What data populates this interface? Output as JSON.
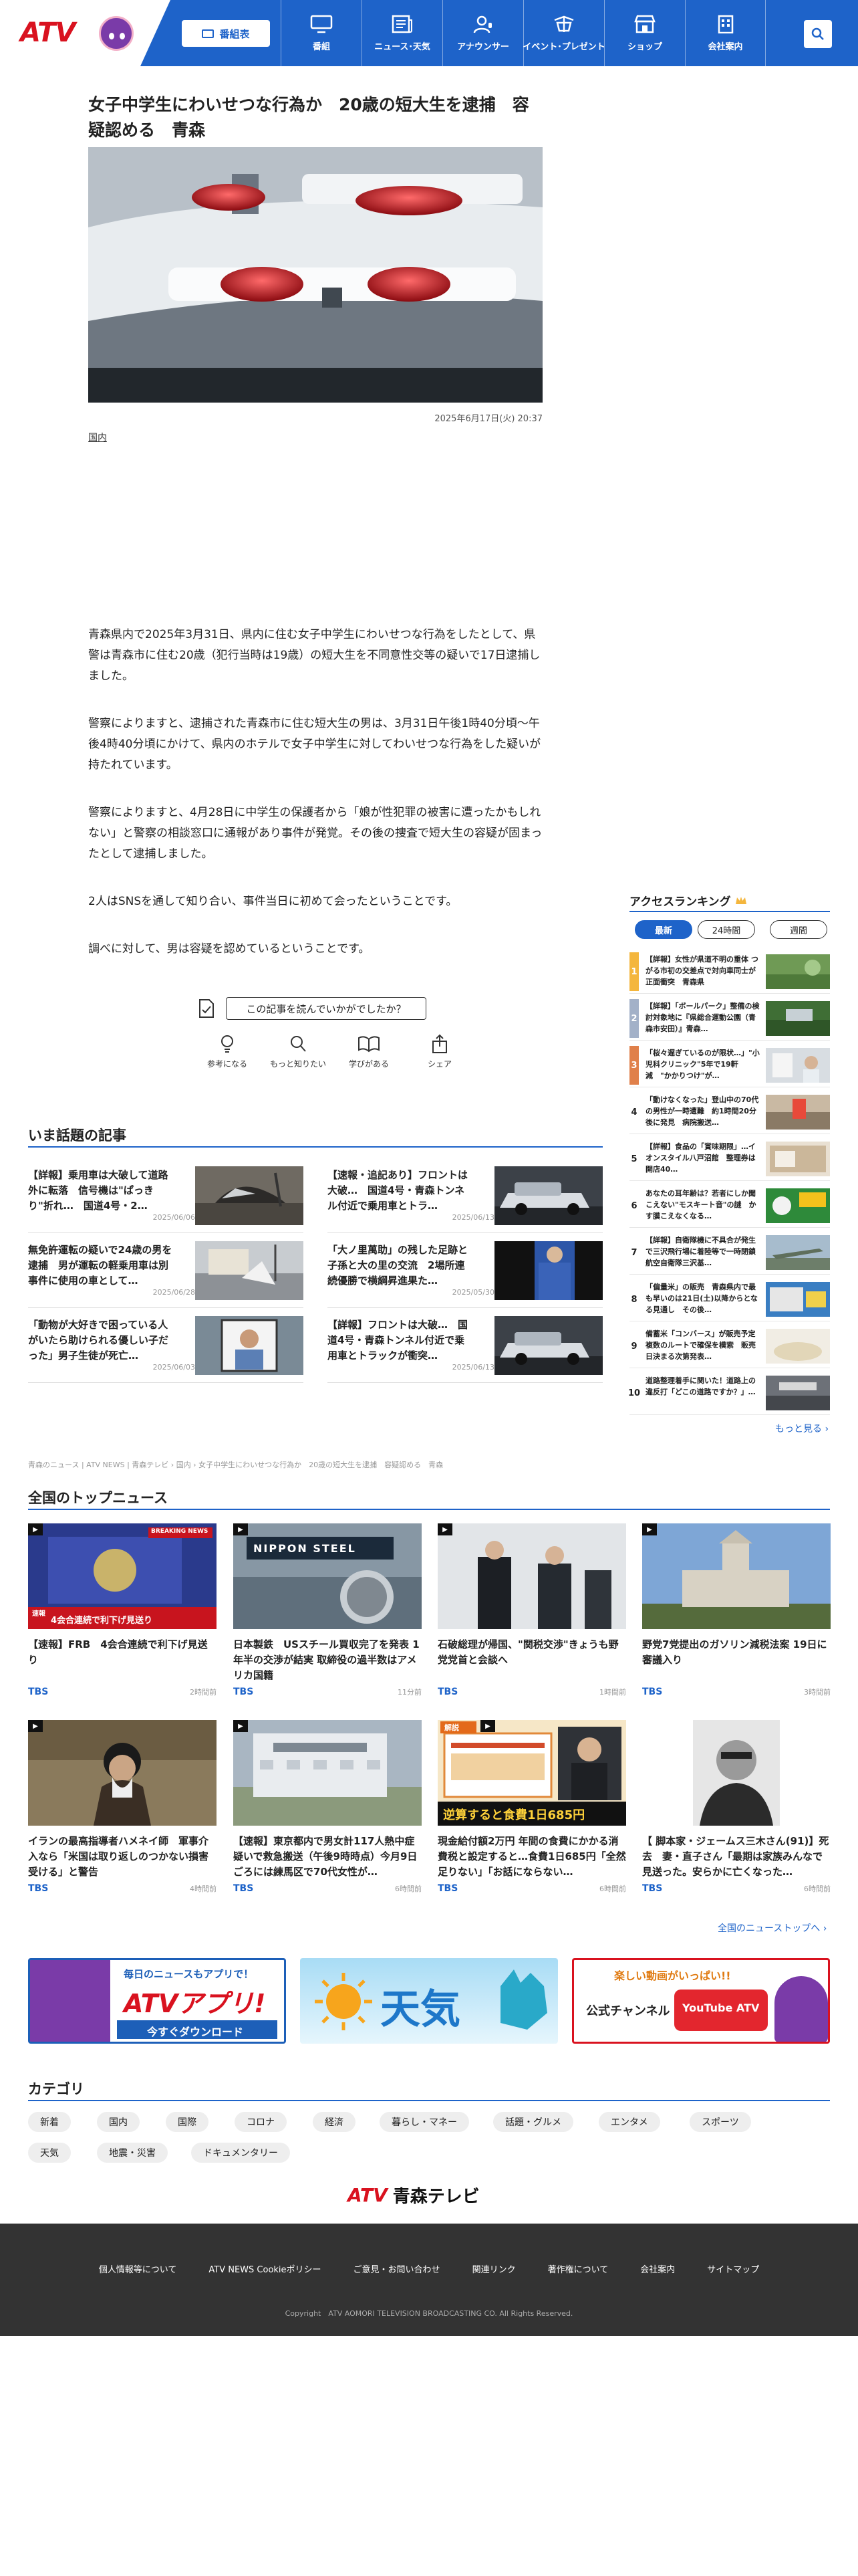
{
  "header": {
    "logo_text": "ATV",
    "program_button": "番組表",
    "nav": [
      {
        "label": "番組",
        "icon": "tv-icon"
      },
      {
        "label": "ニュース･天気",
        "icon": "news-icon"
      },
      {
        "label": "アナウンサー",
        "icon": "announcer-icon"
      },
      {
        "label": "イベント･プレゼント",
        "icon": "event-icon"
      },
      {
        "label": "ショップ",
        "icon": "shop-icon"
      },
      {
        "label": "会社案内",
        "icon": "building-icon"
      }
    ]
  },
  "article": {
    "title": "女子中学生にわいせつな行為か　20歳の短大生を逮捕　容疑認める　青森",
    "date": "2025年6月17日(火) 20:37",
    "category": "国内",
    "paragraphs": [
      "青森県内で2025年3月31日、県内に住む女子中学生にわいせつな行為をしたとして、県警は青森市に住む20歳（犯行当時は19歳）の短大生を不同意性交等の疑いで17日逮捕しました。",
      "警察によりますと、逮捕された青森市に住む短大生の男は、3月31日午後1時40分頃～午後4時40分頃にかけて、県内のホテルで女子中学生に対してわいせつな行為をした疑いが持たれています。",
      "警察によりますと、4月28日に中学生の保護者から「娘が性犯罪の被害に遭ったかもしれない」と警察の相談窓口に通報があり事件が発覚。その後の捜査で短大生の容疑が固まったとして逮捕しました。",
      "2人はSNSを通して知り合い、事件当日に初めて会ったということです。",
      "調べに対して、男は容疑を認めているということです。"
    ],
    "reaction_question": "この記事を読んでいかがでしたか？",
    "reactions": [
      {
        "label": "参考になる",
        "icon": "lightbulb-icon"
      },
      {
        "label": "もっと知りたい",
        "icon": "magnifier-icon"
      },
      {
        "label": "学びがある",
        "icon": "book-icon"
      },
      {
        "label": "シェア",
        "icon": "share-icon"
      }
    ]
  },
  "hot": {
    "title": "いま話題の記事",
    "items": [
      {
        "text": "【詳報】乗用車は大破して道路外に転落　信号機は\"ぱっきり\"折れ…　国道4号・2…",
        "date": "2025/06/06"
      },
      {
        "text": "【速報・追記あり】フロントは大破…　国道4号・青森トンネル付近で乗用車とトラ…",
        "date": "2025/06/13"
      },
      {
        "text": "無免許運転の疑いで24歳の男を逮捕　男が運転の軽乗用車は別事件に使用の車として…",
        "date": "2025/06/28"
      },
      {
        "text": "「大ノ里萬助」の残した足跡と子孫と大の里の交流　2場所連続優勝で横綱昇進果た…",
        "date": "2025/05/30"
      },
      {
        "text": "「動物が大好きで困っている人がいたら助けられる優しい子だった」男子生徒が死亡…",
        "date": "2025/06/03"
      },
      {
        "text": "【詳報】フロントは大破…　国道4号・青森トンネル付近で乗用車とトラックが衝突…",
        "date": "2025/06/13"
      }
    ]
  },
  "breadcrumb": "青森のニュース | ATV NEWS | 青森テレビ  ›  国内  ›  女子中学生にわいせつな行為か　20歳の短大生を逮捕　容疑認める　青森",
  "national": {
    "title": "全国のトップニュース",
    "more": "全国のニューストップへ ›",
    "items": [
      {
        "text": "【速報】FRB　4会合連続で利下げ見送り",
        "src": "TBS",
        "time": "2時間前",
        "overlay": "4会合連続で利下げ見送り",
        "tag": "速報",
        "badge": "BREAKING NEWS"
      },
      {
        "text": "日本製鉄　USスチール買収完了を発表 1年半の交渉が結実 取締役の過半数はアメリカ国籍",
        "src": "TBS",
        "time": "11分前",
        "overlay": "",
        "tag": "",
        "badge": "NIPPON STEEL"
      },
      {
        "text": "石破総理が帰国、\"関税交渉\"きょうも野党党首と会談へ",
        "src": "TBS",
        "time": "1時間前",
        "overlay": "",
        "tag": "",
        "badge": ""
      },
      {
        "text": "野党7党提出のガソリン減税法案 19日に審議入り",
        "src": "TBS",
        "time": "3時間前",
        "overlay": "",
        "tag": "",
        "badge": ""
      },
      {
        "text": "イランの最高指導者ハメネイ師　軍事介入なら「米国は取り返しのつかない損害受ける」と警告",
        "src": "TBS",
        "time": "4時間前",
        "overlay": "",
        "tag": "",
        "badge": ""
      },
      {
        "text": "【速報】東京都内で男女計117人熱中症疑いで救急搬送（午後9時時点）今月9日ごろには練馬区で70代女性が…",
        "src": "TBS",
        "time": "6時間前",
        "overlay": "",
        "tag": "",
        "badge": ""
      },
      {
        "text": "現金給付額2万円 年間の食費にかかる消費税と設定すると…食費1日685円「全然足りない」「お話にならない…",
        "src": "TBS",
        "time": "6時間前",
        "overlay": "逆算すると食費1日685円",
        "tag": "解説",
        "badge": ""
      },
      {
        "text": "【 脚本家・ジェームス三木さん(91)】死去　妻・直子さん「最期は家族みんなで見送った。安らかに亡くなった…",
        "src": "TBS",
        "time": "6時間前",
        "overlay": "",
        "tag": "",
        "badge": ""
      }
    ]
  },
  "banners": [
    {
      "top": "毎日のニュースもアプリで！",
      "main": "ATVアプリ!",
      "sub": "今すぐダウンロード"
    },
    {
      "main": "天気"
    },
    {
      "top": "楽しい動画がいっぱい!!",
      "main": "公式チャンネル",
      "sub": "YouTube ATV"
    }
  ],
  "categories": {
    "title": "カテゴリ",
    "items": [
      "新着",
      "国内",
      "国際",
      "コロナ",
      "経済",
      "暮らし・マネー",
      "話題・グルメ",
      "エンタメ",
      "スポーツ",
      "天気",
      "地震・災害",
      "ドキュメンタリー"
    ]
  },
  "footer": {
    "logo_brand": "ATV",
    "logo_name": "青森テレビ",
    "links": [
      "個人情報等について",
      "ATV NEWS Cookieポリシー",
      "ご意見・お問い合わせ",
      "関連リンク",
      "著作権について",
      "会社案内",
      "サイトマップ"
    ],
    "copyright": "Copyright　ATV AOMORI TELEVISION BROADCASTING CO. All Rights Reserved."
  },
  "ranking": {
    "title": "アクセスランキング",
    "tabs": [
      "最新",
      "24時間",
      "週間"
    ],
    "more": "もっと見る ›",
    "items": [
      {
        "rank": "1",
        "text": "【詳報】女性が県道不明の重体 つがる市初の交差点で対向車同士が正面衝突　青森県"
      },
      {
        "rank": "2",
        "text": "【詳報】「ボールパーク」整備の検討対象地に『県総合運動公園（青森市安田）』青森…"
      },
      {
        "rank": "3",
        "text": "「桜々遅ぎているのが限状…」\"小児科クリニック\"5年で19軒減　\"かかりつけ\"が…"
      },
      {
        "rank": "4",
        "text": "「動けなくなった」登山中の70代の男性が一時遭難　約1時間20分後に発見　病院搬送…"
      },
      {
        "rank": "5",
        "text": "【詳報】食品の「賞味期限」…イオンスタイル八戸沼館　整理券は開店40…"
      },
      {
        "rank": "6",
        "text": "あなたの耳年齢は？若者にしか聞こえない\"モスキート音\"の謎　かす膜こえなくなる…"
      },
      {
        "rank": "7",
        "text": "【詳報】自衛隊機に不具合が発生で三沢飛行場に着陸等で一時閉鎖　航空自衛隊三沢基…"
      },
      {
        "rank": "8",
        "text": "「偏量米」の販売　青森県内で最も早いのは21日(土)以降からとなる見通し　その後…"
      },
      {
        "rank": "9",
        "text": "備蓄米「コンバース」が販売予定　複数のルートで確保を模索　販売日決まる次第発表…"
      },
      {
        "rank": "10",
        "text": "道路整理着手に関いた！道路上の違反打「どこの道路ですか？」…"
      }
    ]
  }
}
